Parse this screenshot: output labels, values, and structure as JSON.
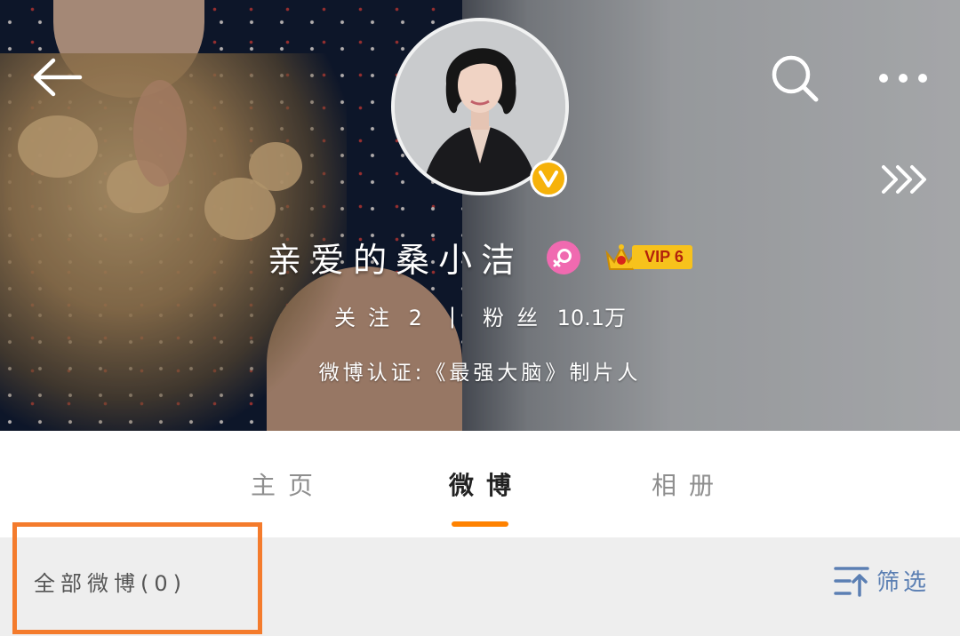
{
  "header": {
    "back_icon": "arrow-left-icon",
    "search_icon": "search-icon",
    "more_icon": "more-dots-icon",
    "swipe_icon": "chevrons-right-icon"
  },
  "profile": {
    "name": "亲爱的桑小洁",
    "gender_icon": "female-icon",
    "verified_icon": "verified-v-icon",
    "vip_label": "VIP 6",
    "following_label": "关注",
    "following_count": "2",
    "separator": "|",
    "followers_label": "粉丝",
    "followers_count": "10.1万",
    "verification": "微博认证:《最强大脑》制片人"
  },
  "tabs": [
    {
      "label": "主页",
      "active": false
    },
    {
      "label": "微博",
      "active": true
    },
    {
      "label": "相册",
      "active": false
    }
  ],
  "feed": {
    "all_weibo_label": "全部微博(0)",
    "filter_label": "筛选",
    "filter_icon": "filter-sort-icon"
  },
  "colors": {
    "accent": "#ff8200",
    "highlight": "#f47b2c",
    "filter_text": "#5b7fb3",
    "vip_gold": "#f7c21c",
    "gender_pink": "#f06ab0"
  }
}
